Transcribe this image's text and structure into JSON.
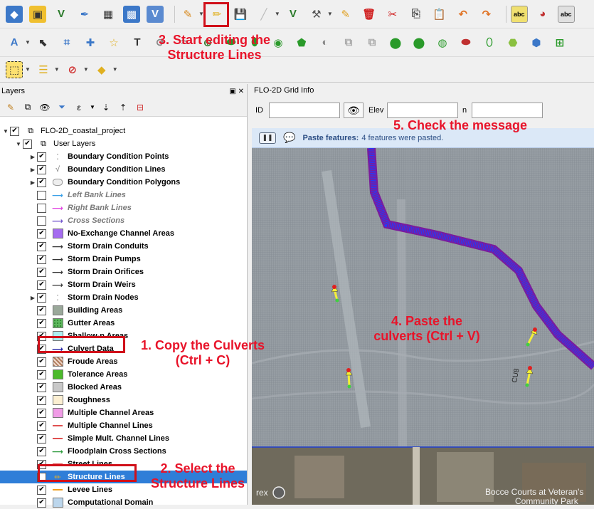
{
  "layers_panel": {
    "title": "Layers",
    "project_name": "FLO-2D_coastal_project",
    "group_name": "User Layers",
    "items": [
      {
        "label": "Boundary Condition Points",
        "style": "bold",
        "checked": true,
        "expandable": true,
        "symbol": "points"
      },
      {
        "label": "Boundary Condition Lines",
        "style": "bold",
        "checked": true,
        "expandable": true,
        "symbol": "lines"
      },
      {
        "label": "Boundary Condition Polygons",
        "style": "bold",
        "checked": true,
        "expandable": true,
        "symbol": "polygon-outline"
      },
      {
        "label": "Left Bank Lines",
        "style": "italic",
        "checked": false,
        "expandable": false,
        "symbol": "arrow-cyan",
        "color": "#3aa0e8"
      },
      {
        "label": "Right Bank Lines",
        "style": "italic",
        "checked": false,
        "expandable": false,
        "symbol": "arrow-magenta",
        "color": "#e040e0"
      },
      {
        "label": "Cross Sections",
        "style": "italic",
        "checked": false,
        "expandable": false,
        "symbol": "arrow-purple",
        "color": "#6a4cc8"
      },
      {
        "label": "No-Exchange Channel Areas",
        "style": "bold",
        "checked": true,
        "expandable": false,
        "symbol": "fill",
        "color": "#a56cf0"
      },
      {
        "label": "Storm Drain Conduits",
        "style": "bold",
        "checked": true,
        "expandable": false,
        "symbol": "arrow-dark",
        "color": "#333333"
      },
      {
        "label": "Storm Drain Pumps",
        "style": "bold",
        "checked": true,
        "expandable": false,
        "symbol": "arrow-dark",
        "color": "#333333"
      },
      {
        "label": "Storm Drain Orifices",
        "style": "bold",
        "checked": true,
        "expandable": false,
        "symbol": "arrow-dark",
        "color": "#333333"
      },
      {
        "label": "Storm Drain Weirs",
        "style": "bold",
        "checked": true,
        "expandable": false,
        "symbol": "arrow-dark",
        "color": "#333333"
      },
      {
        "label": "Storm Drain Nodes",
        "style": "bold",
        "checked": true,
        "expandable": true,
        "symbol": "points"
      },
      {
        "label": "Building Areas",
        "style": "bold",
        "checked": true,
        "expandable": false,
        "symbol": "fill",
        "color": "#9aa89a"
      },
      {
        "label": "Gutter Areas",
        "style": "bold",
        "checked": true,
        "expandable": false,
        "symbol": "fill-dots",
        "color": "#5db85d"
      },
      {
        "label": "Shallow-n Areas",
        "style": "bold",
        "checked": true,
        "expandable": false,
        "symbol": "fill",
        "color": "#aeeef0"
      },
      {
        "label": "Culvert Data",
        "style": "bold",
        "checked": true,
        "expandable": false,
        "symbol": "arrow-navy",
        "color": "#1a1aa0"
      },
      {
        "label": "Froude Areas",
        "style": "bold",
        "checked": true,
        "expandable": false,
        "symbol": "fill-hatch",
        "color": "#b07c5e"
      },
      {
        "label": "Tolerance Areas",
        "style": "bold",
        "checked": true,
        "expandable": false,
        "symbol": "fill",
        "color": "#4cba2c"
      },
      {
        "label": "Blocked Areas",
        "style": "bold",
        "checked": true,
        "expandable": false,
        "symbol": "fill",
        "color": "#c8c8c8"
      },
      {
        "label": "Roughness",
        "style": "bold",
        "checked": true,
        "expandable": false,
        "symbol": "fill",
        "color": "#fcefd2"
      },
      {
        "label": "Multiple Channel Areas",
        "style": "bold",
        "checked": true,
        "expandable": false,
        "symbol": "fill",
        "color": "#f09ce6"
      },
      {
        "label": "Multiple Channel Lines",
        "style": "bold",
        "checked": true,
        "expandable": false,
        "symbol": "line",
        "color": "#e05050"
      },
      {
        "label": "Simple Mult. Channel Lines",
        "style": "bold",
        "checked": true,
        "expandable": false,
        "symbol": "line",
        "color": "#e05050"
      },
      {
        "label": "Floodplain Cross Sections",
        "style": "bold",
        "checked": true,
        "expandable": false,
        "symbol": "arrow-green",
        "color": "#2a9a3a"
      },
      {
        "label": "Street Lines",
        "style": "bold",
        "checked": true,
        "expandable": false,
        "symbol": "line",
        "color": "#e05050"
      },
      {
        "label": "Structure Lines",
        "style": "bold",
        "checked": true,
        "expandable": false,
        "symbol": "pencil",
        "color": "#f0b020",
        "selected": true
      },
      {
        "label": "Levee Lines",
        "style": "bold",
        "checked": true,
        "expandable": false,
        "symbol": "line",
        "color": "#f0a020"
      },
      {
        "label": "Computational Domain",
        "style": "bold",
        "checked": true,
        "expandable": false,
        "symbol": "fill",
        "color": "#bcd6ec"
      }
    ]
  },
  "grid_info": {
    "title": "FLO-2D Grid Info",
    "id_label": "ID",
    "elev_label": "Elev",
    "n_label": "n"
  },
  "message_bar": {
    "title": "Paste features:",
    "text": "4 features were pasted."
  },
  "map": {
    "labels": [
      {
        "text": "Bocce Courts at Veteran's"
      },
      {
        "text": "Community Park"
      },
      {
        "text": "rex"
      },
      {
        "text": "CU8"
      }
    ]
  },
  "annotations": {
    "a1_line1": "1. Copy the Culverts",
    "a1_line2": "(Ctrl + C)",
    "a2_line1": "2. Select the",
    "a2_line2": "Structure Lines",
    "a3_line1": "3. Start editing the",
    "a3_line2": "Structure Lines",
    "a4_line1": "4. Paste the",
    "a4_line2": "culverts (Ctrl + V)",
    "a5": "5. Check the message"
  },
  "toolbar_label_abc": "abc",
  "colors": {
    "annotation": "#e8142a",
    "highlight": "#d0101a",
    "selection": "#2f7ed8",
    "channel_line": "#1e3cff",
    "channel_outline": "#7a1c9c",
    "culvert": "#f2ee3a"
  }
}
